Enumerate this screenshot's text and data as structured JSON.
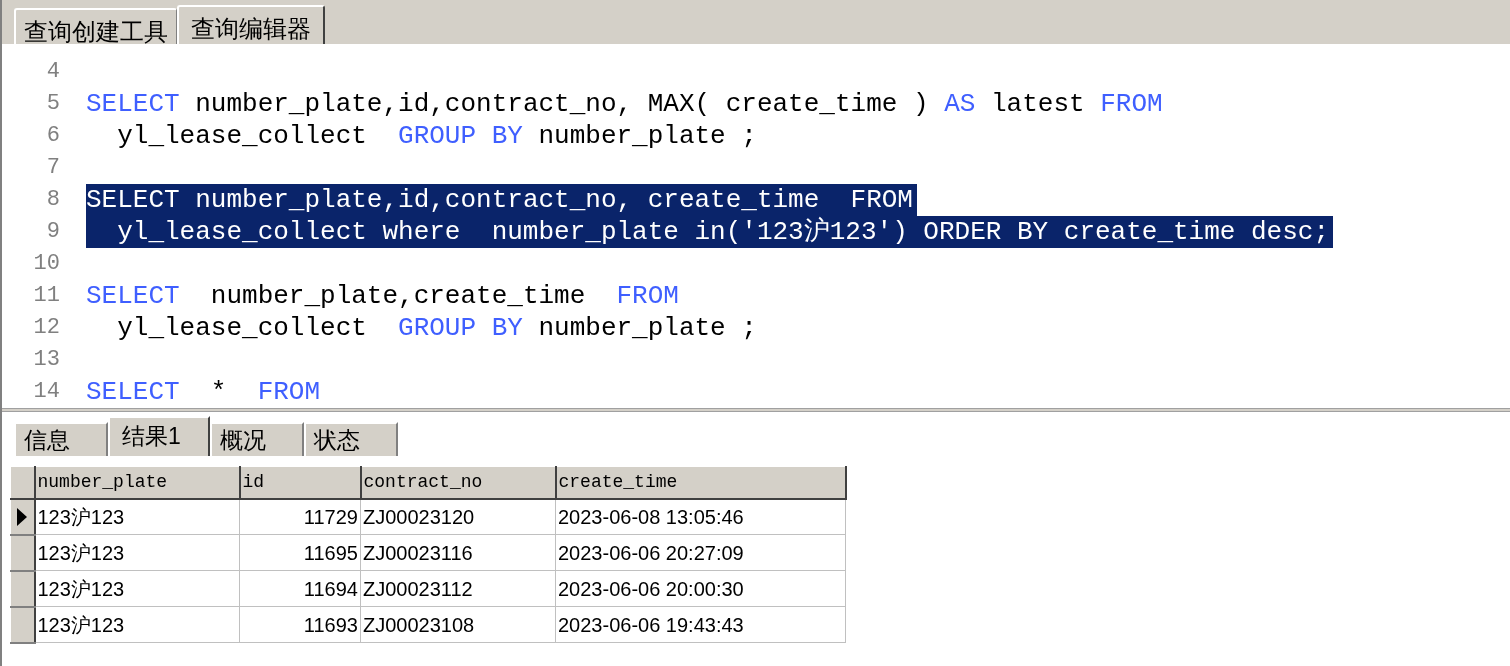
{
  "tabs": [
    {
      "label": "查询创建工具",
      "selected": false
    },
    {
      "label": "查询编辑器",
      "selected": true
    }
  ],
  "editor": {
    "lines": [
      {
        "number": "4",
        "selected": false
      },
      {
        "number": "5",
        "selected": false,
        "tokens": [
          {
            "kind": "keyword",
            "text": "SELECT"
          },
          {
            "kind": "plain",
            "text": " number_plate,id,contract_no, MAX( create_time ) "
          },
          {
            "kind": "keyword",
            "text": "AS"
          },
          {
            "kind": "plain",
            "text": " latest "
          },
          {
            "kind": "keyword",
            "text": "FROM"
          }
        ]
      },
      {
        "number": "6",
        "selected": false,
        "tokens": [
          {
            "kind": "plain",
            "text": "  yl_lease_collect  "
          },
          {
            "kind": "keyword",
            "text": "GROUP BY"
          },
          {
            "kind": "plain",
            "text": " number_plate ;"
          }
        ]
      },
      {
        "number": "7",
        "selected": false
      },
      {
        "number": "8",
        "selected": true,
        "tokens": [
          {
            "kind": "keyword",
            "text": "SELECT"
          },
          {
            "kind": "plain",
            "text": " number_plate,id,contract_no, create_time  "
          },
          {
            "kind": "keyword",
            "text": "FROM"
          }
        ]
      },
      {
        "number": "9",
        "selected": true,
        "tokens": [
          {
            "kind": "plain",
            "text": "  yl_lease_collect where  number_plate in('123沪123') "
          },
          {
            "kind": "keyword",
            "text": "ORDER BY"
          },
          {
            "kind": "plain",
            "text": " create_time desc;"
          }
        ]
      },
      {
        "number": "10",
        "selected": false
      },
      {
        "number": "11",
        "selected": false,
        "tokens": [
          {
            "kind": "keyword",
            "text": "SELECT"
          },
          {
            "kind": "plain",
            "text": "  number_plate,create_time  "
          },
          {
            "kind": "keyword",
            "text": "FROM"
          }
        ]
      },
      {
        "number": "12",
        "selected": false,
        "tokens": [
          {
            "kind": "plain",
            "text": "  yl_lease_collect  "
          },
          {
            "kind": "keyword",
            "text": "GROUP BY"
          },
          {
            "kind": "plain",
            "text": " number_plate ;"
          }
        ]
      },
      {
        "number": "13",
        "selected": false
      },
      {
        "number": "14",
        "selected": false,
        "tokens": [
          {
            "kind": "keyword",
            "text": "SELECT"
          },
          {
            "kind": "plain",
            "text": "  *  "
          },
          {
            "kind": "keyword",
            "text": "FROM"
          }
        ]
      }
    ]
  },
  "result_tabs": [
    {
      "label": "信息",
      "selected": false
    },
    {
      "label": "结果1",
      "selected": true
    },
    {
      "label": "概况",
      "selected": false
    },
    {
      "label": "状态",
      "selected": false
    }
  ],
  "table": {
    "columns": [
      "number_plate",
      "id",
      "contract_no",
      "create_time"
    ],
    "rows": [
      {
        "selected": true,
        "cells": [
          "123沪123",
          "11729",
          "ZJ00023120",
          "2023-06-08 13:05:46"
        ]
      },
      {
        "selected": false,
        "cells": [
          "123沪123",
          "11695",
          "ZJ00023116",
          "2023-06-06 20:27:09"
        ]
      },
      {
        "selected": false,
        "cells": [
          "123沪123",
          "11694",
          "ZJ00023112",
          "2023-06-06 20:00:30"
        ]
      },
      {
        "selected": false,
        "cells": [
          "123沪123",
          "11693",
          "ZJ00023108",
          "2023-06-06 19:43:43"
        ]
      }
    ]
  }
}
